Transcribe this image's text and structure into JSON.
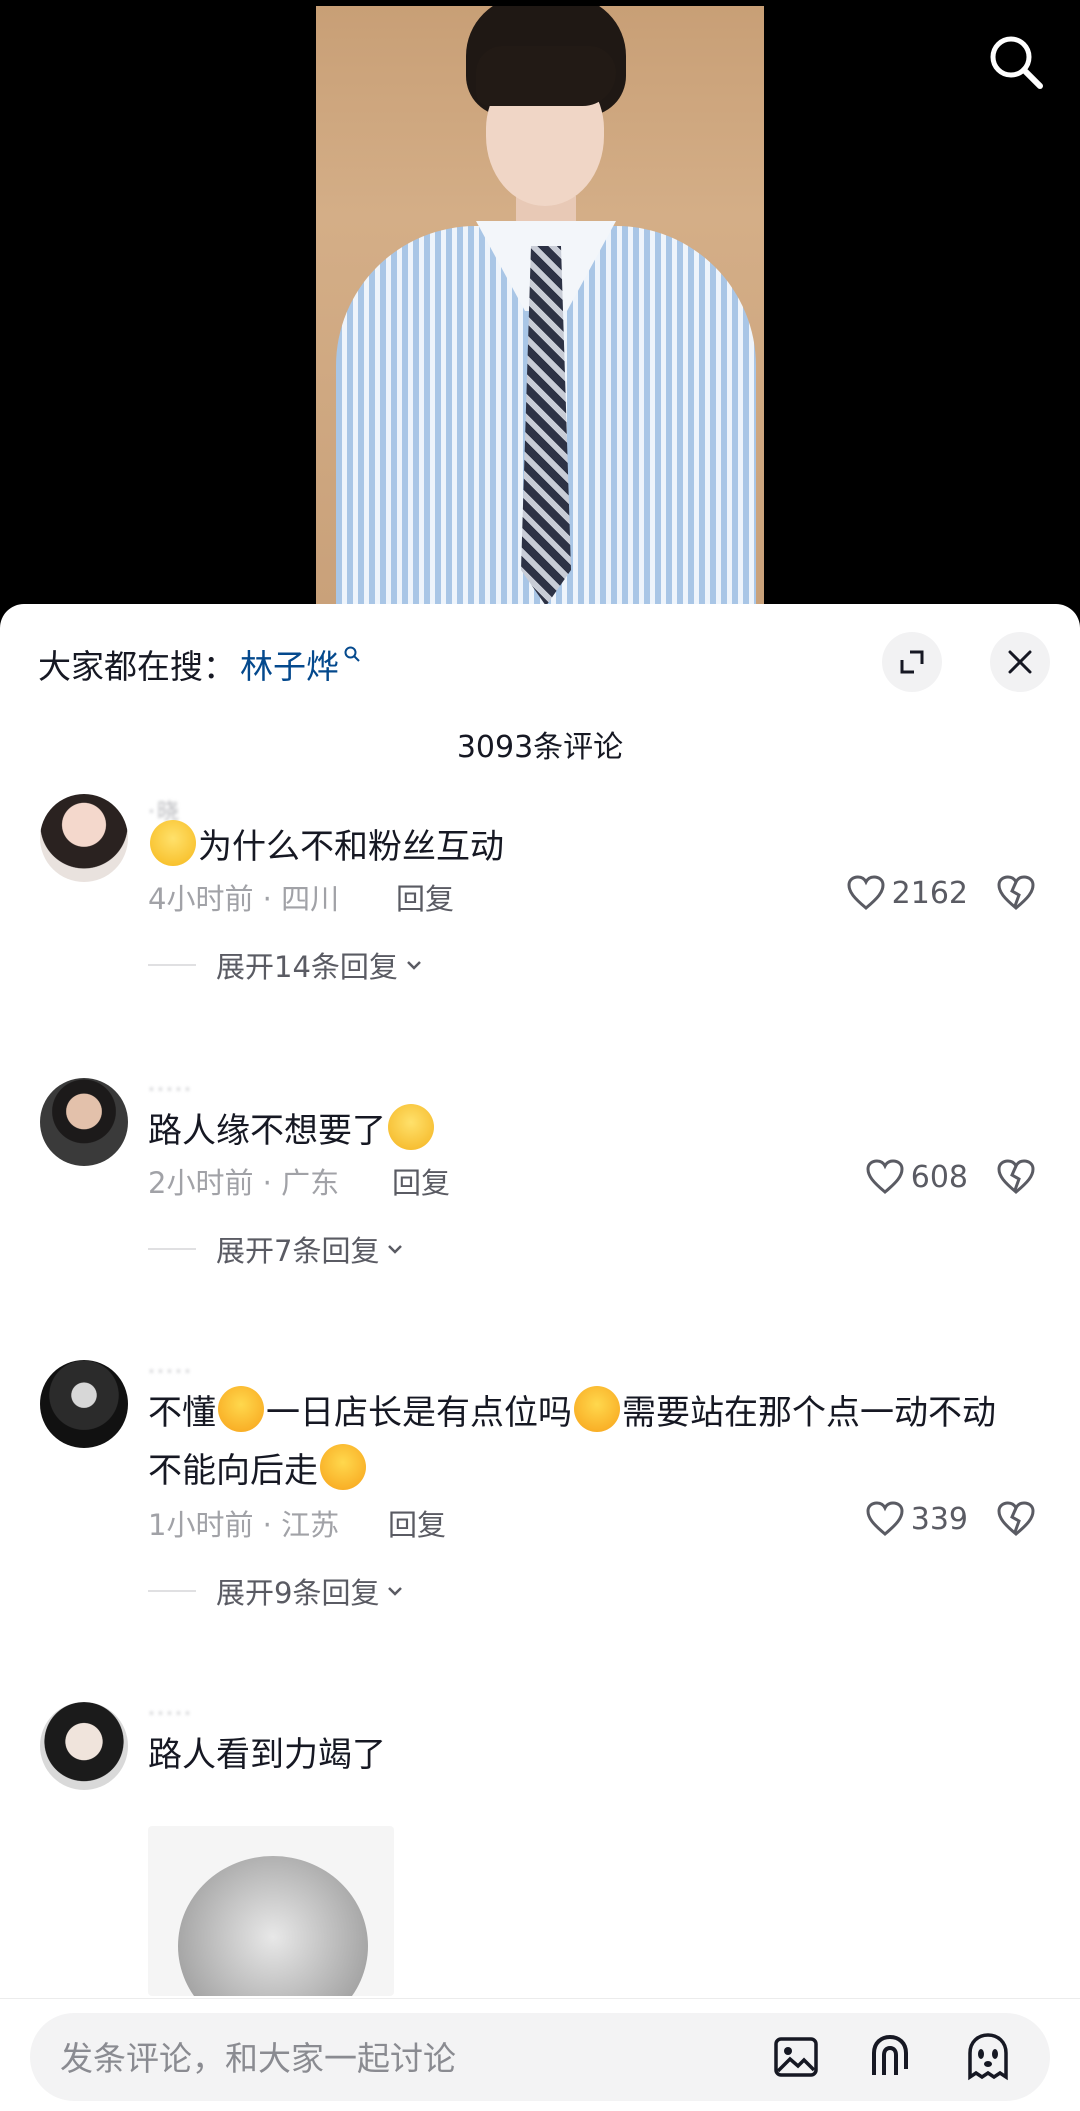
{
  "video": {
    "search_icon": "search-icon"
  },
  "header": {
    "hot_prefix": "大家都在搜：",
    "hot_keyword": "林子烨",
    "expand_icon": "expand-icon",
    "close_icon": "close-icon"
  },
  "comment_count": "3093条评论",
  "comments": [
    {
      "user": "·晓",
      "text": "为什么不和粉丝互动",
      "time_location": "4小时前 · 四川",
      "reply_label": "回复",
      "likes": "2162",
      "expand_label": "展开14条回复"
    },
    {
      "user": "·····",
      "text": "路人缘不想要了",
      "time_location": "2小时前 · 广东",
      "reply_label": "回复",
      "likes": "608",
      "expand_label": "展开7条回复"
    },
    {
      "user": "·····",
      "text_parts": [
        "不懂",
        "一日店长是有点位吗",
        "需要站在那个点一动不动 不能向后走"
      ],
      "time_location": "1小时前 · 江苏",
      "reply_label": "回复",
      "likes": "339",
      "expand_label": "展开9条回复"
    },
    {
      "user": "·····",
      "text": "路人看到力竭了"
    }
  ],
  "bottom_bar": {
    "placeholder": "发条评论，和大家一起讨论",
    "icons": [
      "image-icon",
      "at-mention-icon",
      "emoji-icon"
    ]
  }
}
